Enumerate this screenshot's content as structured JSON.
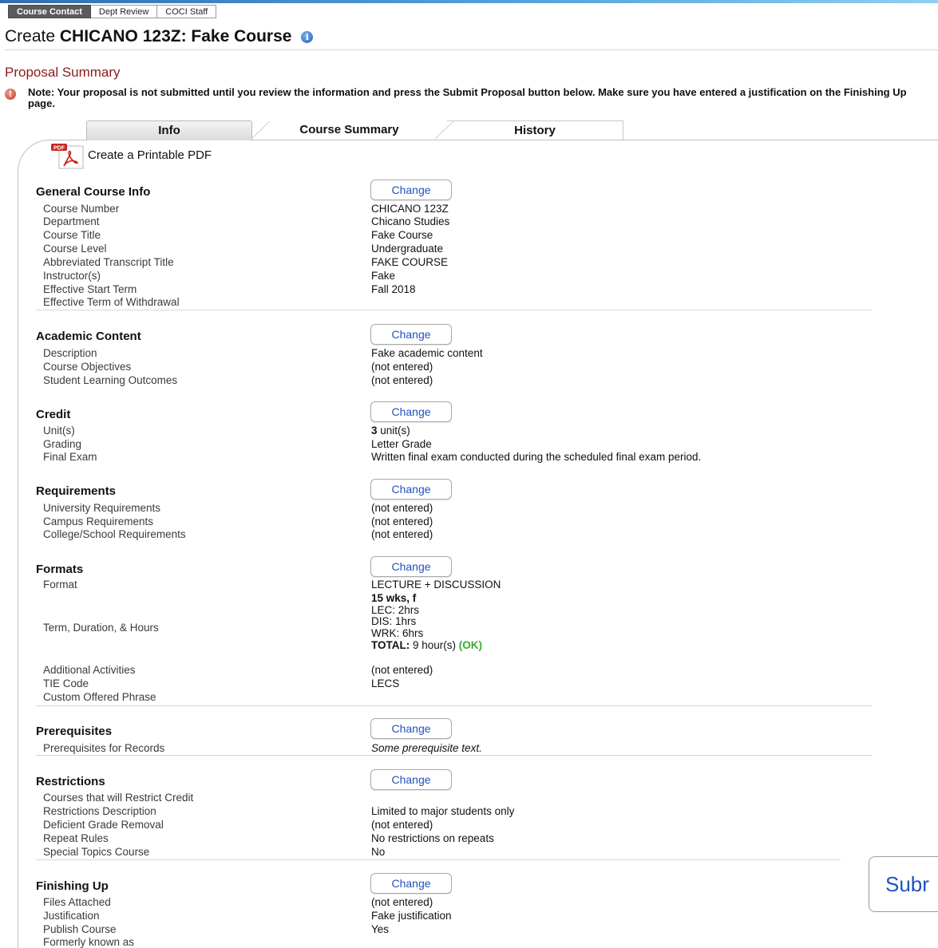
{
  "role_tabs": [
    "Course Contact",
    "Dept Review",
    "COCI Staff"
  ],
  "page": {
    "title_prefix": "Create",
    "title_bold": "CHICANO 123Z: Fake Course",
    "info_icon": "info-circle-icon"
  },
  "summary": {
    "heading": "Proposal Summary",
    "note_icon": "alert-circle-icon",
    "note": "Note: Your proposal is not submitted until you review the information and press the Submit Proposal button below. Make sure you have entered a justification on the Finishing Up page."
  },
  "tabs": [
    "Info",
    "Course Summary",
    "History"
  ],
  "pdf": {
    "icon": "pdf-icon",
    "badge": "PDF",
    "label": "Create a Printable PDF"
  },
  "change_label": "Change",
  "general": {
    "title": "General Course Info",
    "labels": [
      "Course Number",
      "Department",
      "Course Title",
      "Course Level",
      "Abbreviated Transcript Title",
      "Instructor(s)",
      "Effective Start Term",
      "Effective Term of Withdrawal"
    ],
    "values": [
      "CHICANO 123Z",
      "Chicano Studies",
      "Fake Course",
      "Undergraduate",
      "FAKE COURSE",
      "Fake",
      "Fall 2018",
      ""
    ]
  },
  "academic": {
    "title": "Academic Content",
    "labels": [
      "Description",
      "Course Objectives",
      "Student Learning Outcomes"
    ],
    "values": [
      "Fake academic content",
      "(not entered)",
      "(not entered)"
    ]
  },
  "credit": {
    "title": "Credit",
    "labels": [
      "Unit(s)",
      "Grading",
      "Final Exam"
    ],
    "units_number": "3",
    "units_suffix": " unit(s)",
    "grading": "Letter Grade",
    "final_exam": "Written final exam conducted during the scheduled final exam period."
  },
  "requirements": {
    "title": "Requirements",
    "labels": [
      "University Requirements",
      "Campus Requirements",
      "College/School Requirements"
    ],
    "values": [
      "(not entered)",
      "(not entered)",
      "(not entered)"
    ]
  },
  "formats": {
    "title": "Formats",
    "format_label": "Format",
    "format_value": "LECTURE + DISCUSSION",
    "term_label": "Term, Duration, & Hours",
    "term_head": "15 wks, f",
    "lines": [
      "LEC: 2hrs",
      "DIS: 1hrs",
      "WRK: 6hrs"
    ],
    "total_label": "TOTAL:",
    "total_value": " 9 hour(s) ",
    "total_status": "(OK)",
    "labels": [
      "Additional Activities",
      "TIE Code",
      "Custom Offered Phrase"
    ],
    "values": [
      "(not entered)",
      "LECS",
      ""
    ]
  },
  "prerequisites": {
    "title": "Prerequisites",
    "label": "Prerequisites for Records",
    "value": "Some prerequisite text."
  },
  "restrictions": {
    "title": "Restrictions",
    "labels": [
      "Courses that will Restrict Credit",
      "Restrictions Description",
      "Deficient Grade Removal",
      "Repeat Rules",
      "Special Topics Course"
    ],
    "values": [
      "",
      "Limited to major students only",
      "(not entered)",
      "No restrictions on repeats",
      "No"
    ]
  },
  "finishing": {
    "title": "Finishing Up",
    "labels": [
      "Files Attached",
      "Justification",
      "Publish Course",
      "Formerly known as"
    ],
    "values": [
      "(not entered)",
      "Fake justification",
      "Yes",
      ""
    ]
  },
  "submit_label": "Subr"
}
